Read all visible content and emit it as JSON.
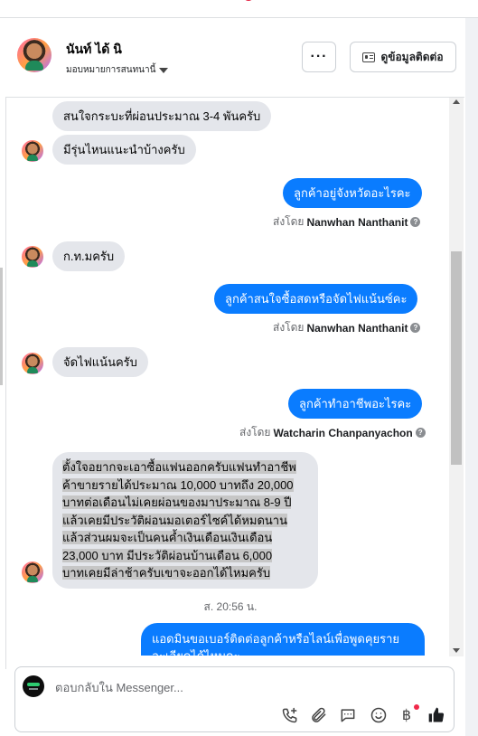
{
  "header": {
    "contact_name": "นันท์ ได้ นิ",
    "assign_label": "มอบหมายการสนทนานี้",
    "more_label": "···",
    "info_button_label": "ดูข้อมูลติดต่อ"
  },
  "messages": {
    "m1": "สนใจกระบะที่ผ่อนประมาณ 3-4 พันครับ",
    "m2": "มีรุ่นไหนแนะนำบ้างครับ",
    "m3": "ลูกค้าอยู่จังหวัดอะไรคะ",
    "m3_sent_prefix": "ส่งโดย",
    "m3_sender": "Nanwhan Nanthanit",
    "m4": "ก.ท.มครับ",
    "m5": "ลูกค้าสนใจซื้อสดหรือจัดไฟแน้นซ์คะ",
    "m5_sent_prefix": "ส่งโดย",
    "m5_sender": "Nanwhan Nanthanit",
    "m6": "จัดไฟแน้นครับ",
    "m7": "ลูกค้าทำอาชีพอะไรคะ",
    "m7_sent_prefix": "ส่งโดย",
    "m7_sender": "Watcharin Chanpanyachon",
    "m8_lines": [
      "ตั้งใจอยากจะเอาซื้อแฟนออกครับแฟนทำอาชีพ",
      "ค้าขายรายได้ประมาณ 10,000 บาทถึง 20,000",
      "บาทต่อเดือนไม่เคยผ่อนของมาประมาณ 8-9 ปี",
      "แล้วเคยมีประวัติผ่อนมอเตอร์ไซค์ได้หมดนาน",
      "แล้วส่วนผมจะเป็นคนค้ำเงินเดือนเงินเดือน",
      "23,000 บาท มีประวัติผ่อนบ้านเดือน 6,000",
      "บาทเคยมีล่าช้าครับเขาจะออกได้ไหมครับ"
    ],
    "timestamp": "ส. 20:56 น.",
    "m9_line1": "แอดมินขอเบอร์ติดต่อลูกค้าหรือไลน์เพื่อพูดคุยราย",
    "m9_line2": "ละเอียดได้ไหมคะ"
  },
  "composer": {
    "placeholder": "ตอบกลับใน Messenger...",
    "baht_label": "฿"
  },
  "colors": {
    "outgoing_bubble": "#0a7cff",
    "incoming_bubble": "#e4e6eb",
    "like_icon": "#1c1e21"
  }
}
